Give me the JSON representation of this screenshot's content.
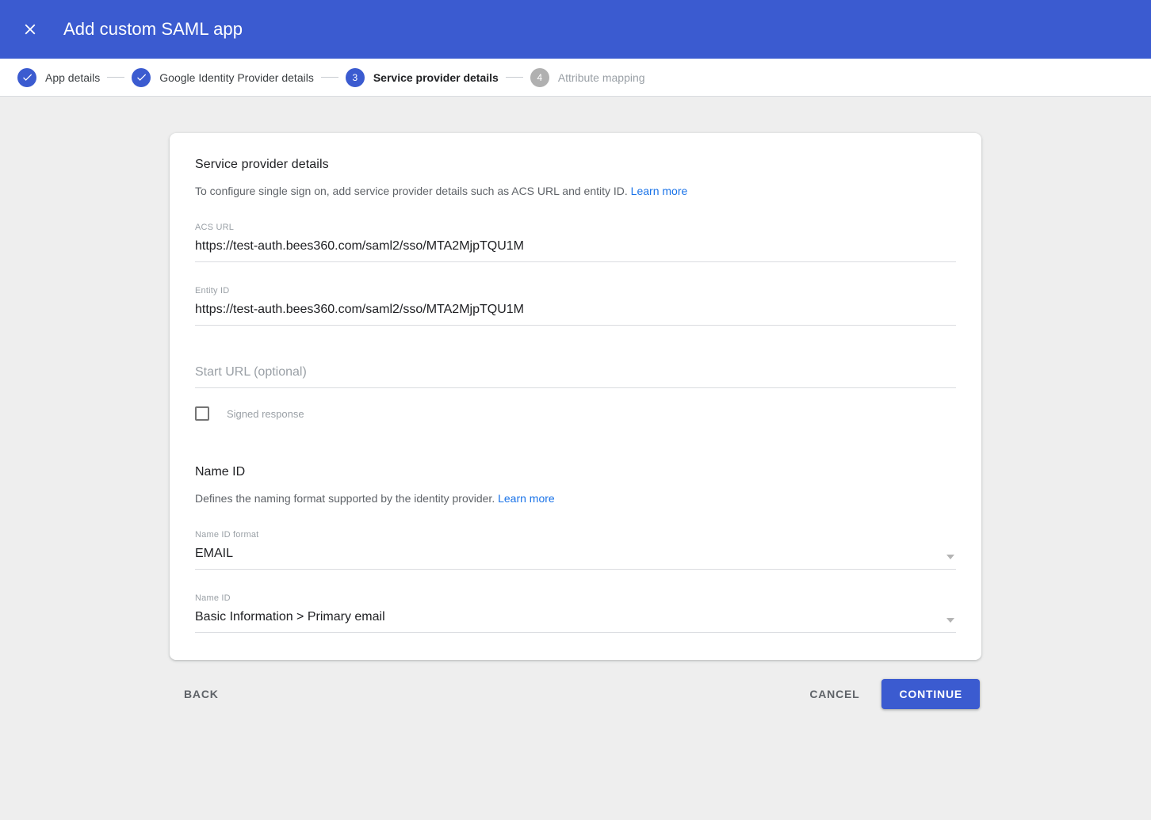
{
  "header": {
    "title": "Add custom SAML app",
    "close_icon": "close-icon",
    "background": "#3b5bd0"
  },
  "stepper": {
    "steps": [
      {
        "num": "1",
        "label": "App details",
        "state": "done"
      },
      {
        "num": "2",
        "label": "Google Identity Provider details",
        "state": "done"
      },
      {
        "num": "3",
        "label": "Service provider details",
        "state": "active"
      },
      {
        "num": "4",
        "label": "Attribute mapping",
        "state": "todo"
      }
    ],
    "check_icon": "check-icon",
    "active_color": "#3b5bd0",
    "todo_color": "#b0b0b0"
  },
  "card": {
    "title": "Service provider details",
    "description": "To configure single sign on, add service provider details such as ACS URL and entity ID.",
    "learn_more": "Learn more",
    "fields": {
      "acs_url": {
        "label": "ACS URL",
        "value": "https://test-auth.bees360.com/saml2/sso/MTA2MjpTQU1M"
      },
      "entity_id": {
        "label": "Entity ID",
        "value": "https://test-auth.bees360.com/saml2/sso/MTA2MjpTQU1M"
      },
      "start_url": {
        "label": "",
        "value": "",
        "placeholder": "Start URL (optional)"
      },
      "signed_response": {
        "label": "Signed response",
        "checked": false
      }
    },
    "name_id_section": {
      "title": "Name ID",
      "description": "Defines the naming format supported by the identity provider.",
      "learn_more": "Learn more",
      "name_id_format": {
        "label": "Name ID format",
        "value": "EMAIL",
        "caret_icon": "chevron-down-icon"
      },
      "name_id": {
        "label": "Name ID",
        "value": "Basic Information > Primary email",
        "caret_icon": "chevron-down-icon"
      }
    }
  },
  "actions": {
    "back": "BACK",
    "cancel": "CANCEL",
    "continue": "CONTINUE",
    "primary_color": "#3b5bd0"
  },
  "page": {
    "background": "#eeeeee"
  }
}
